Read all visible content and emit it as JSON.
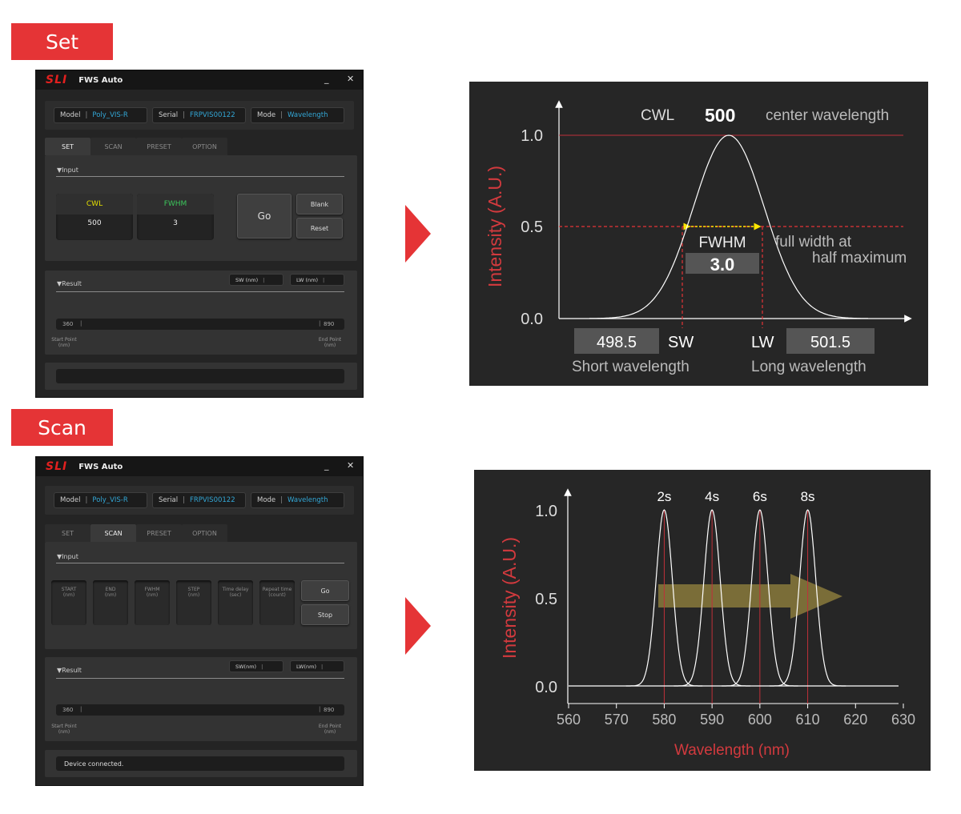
{
  "labels": {
    "set": "Set",
    "scan": "Scan"
  },
  "window": {
    "logo": "SLI",
    "title": "FWS Auto",
    "minimize": "_",
    "close": "✕"
  },
  "info": {
    "model_label": "Model",
    "model_value": "Poly_VIS-R",
    "serial_label": "Serial",
    "serial_value": "FRPVIS00122",
    "mode_label": "Mode",
    "mode_value": "Wavelength"
  },
  "tabs": [
    "SET",
    "SCAN",
    "PRESET",
    "OPTION"
  ],
  "set_panel": {
    "input_title": "▼Input",
    "cwl_label": "CWL",
    "cwl_value": "500",
    "fwhm_label": "FWHM",
    "fwhm_value": "3",
    "go": "Go",
    "blank": "Blank",
    "reset": "Reset",
    "result_title": "▼Result",
    "sw_label": "SW (nm)",
    "lw_label": "LW (nm)",
    "start": "360",
    "end": "890",
    "start_point": "Start Point",
    "end_point": "End Point",
    "nm": "(nm)",
    "status": ""
  },
  "scan_panel": {
    "input_title": "▼Input",
    "params": [
      {
        "l1": "START",
        "l2": "(nm)"
      },
      {
        "l1": "END",
        "l2": "(nm)"
      },
      {
        "l1": "FWHM",
        "l2": "(nm)"
      },
      {
        "l1": "STEP",
        "l2": "(nm)"
      },
      {
        "l1": "Time delay",
        "l2": "(sec)"
      },
      {
        "l1": "Repeat time",
        "l2": "(count)"
      }
    ],
    "go": "Go",
    "stop": "Stop",
    "result_title": "▼Result",
    "sw_label": "SW(nm)",
    "lw_label": "LW(nm)",
    "start": "360",
    "end": "890",
    "start_point": "Start Point",
    "end_point": "End Point",
    "nm": "(nm)",
    "status": "Device connected."
  },
  "chart_data": [
    {
      "type": "line",
      "ylabel": "Intensity (A.U.)",
      "yticks": [
        "1.0",
        "0.5",
        "0.0"
      ],
      "ylim": [
        0,
        1
      ],
      "series": [
        {
          "x": [
            495,
            497,
            498.5,
            499,
            500,
            501,
            501.5,
            503,
            505
          ],
          "y": [
            0.01,
            0.16,
            0.5,
            0.72,
            1.0,
            0.72,
            0.5,
            0.16,
            0.01
          ]
        }
      ],
      "annotations": {
        "cwl_label": "CWL",
        "cwl_value": "500",
        "cwl_desc": "center wavelength",
        "fwhm_label": "FWHM",
        "fwhm_value": "3.0",
        "fwhm_desc1": "full width at",
        "fwhm_desc2": "half maximum",
        "sw_value": "498.5",
        "sw_label": "SW",
        "sw_desc": "Short wavelength",
        "lw_value": "501.5",
        "lw_label": "LW",
        "lw_desc": "Long wavelength"
      },
      "colors": {
        "curve": "#ffffff",
        "guide": "#e53436",
        "fwhm_arrow": "#ffe600",
        "axis_label": "#d33a3e"
      }
    },
    {
      "type": "line",
      "ylabel": "Intensity (A.U.)",
      "xlabel": "Wavelength (nm)",
      "yticks": [
        "1.0",
        "0.5",
        "0.0"
      ],
      "xticks": [
        560,
        570,
        580,
        590,
        600,
        610,
        620,
        630
      ],
      "xlim": [
        560,
        630
      ],
      "ylim": [
        0,
        1
      ],
      "series": [
        {
          "name": "2s",
          "center": 580,
          "x": [
            572,
            576,
            578,
            580,
            582,
            584,
            588
          ],
          "y": [
            0,
            0.08,
            0.5,
            1.0,
            0.5,
            0.08,
            0
          ]
        },
        {
          "name": "4s",
          "center": 590,
          "x": [
            582,
            586,
            588,
            590,
            592,
            594,
            598
          ],
          "y": [
            0,
            0.08,
            0.5,
            1.0,
            0.5,
            0.08,
            0
          ]
        },
        {
          "name": "6s",
          "center": 600,
          "x": [
            592,
            596,
            598,
            600,
            602,
            604,
            608
          ],
          "y": [
            0,
            0.08,
            0.5,
            1.0,
            0.5,
            0.08,
            0
          ]
        },
        {
          "name": "8s",
          "center": 610,
          "x": [
            602,
            606,
            608,
            610,
            612,
            614,
            618
          ],
          "y": [
            0,
            0.08,
            0.5,
            1.0,
            0.5,
            0.08,
            0
          ]
        }
      ],
      "colors": {
        "curve": "#ffffff",
        "guide": "#c0303a",
        "arrow": "#8a7a3c",
        "axis_label": "#d33a3e"
      }
    }
  ]
}
